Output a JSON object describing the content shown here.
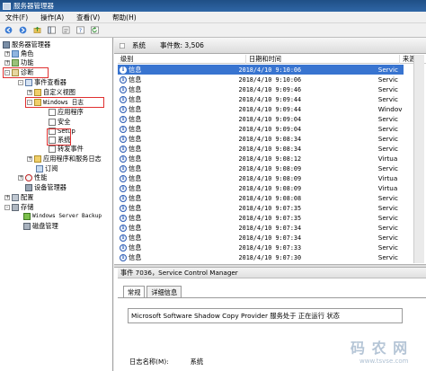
{
  "window": {
    "title": "服务器管理器"
  },
  "menu": [
    "文件(F)",
    "操作(A)",
    "查看(V)",
    "帮助(H)"
  ],
  "toolbar": {
    "icons": [
      "back-arrow-icon",
      "forward-arrow-icon",
      "up-folder-icon",
      "show-tree-icon",
      "properties-icon",
      "help-icon",
      "refresh-icon"
    ]
  },
  "tree": {
    "items": [
      {
        "label": "服务器管理器",
        "icon": "server-icon"
      },
      {
        "label": "角色",
        "icon": "roles-icon"
      },
      {
        "label": "功能",
        "icon": "features-icon"
      },
      {
        "label": "诊断",
        "icon": "diagnostics-icon"
      },
      {
        "label": "事件查看器",
        "icon": "event-viewer-icon"
      },
      {
        "label": "自定义视图",
        "icon": "folder-icon"
      },
      {
        "label": "Windows 日志",
        "icon": "folder-icon"
      },
      {
        "label": "应用程序",
        "icon": "log-icon"
      },
      {
        "label": "安全",
        "icon": "log-icon"
      },
      {
        "label": "Setup",
        "icon": "log-icon"
      },
      {
        "label": "系统",
        "icon": "log-icon"
      },
      {
        "label": "转发事件",
        "icon": "log-icon"
      },
      {
        "label": "应用程序和服务日志",
        "icon": "folder-icon"
      },
      {
        "label": "订阅",
        "icon": "subscription-icon"
      },
      {
        "label": "性能",
        "icon": "performance-icon"
      },
      {
        "label": "设备管理器",
        "icon": "device-manager-icon"
      },
      {
        "label": "配置",
        "icon": "configuration-icon"
      },
      {
        "label": "存储",
        "icon": "storage-icon"
      },
      {
        "label": "Windows Server Backup",
        "icon": "backup-icon"
      },
      {
        "label": "磁盘管理",
        "icon": "disk-icon"
      }
    ]
  },
  "list": {
    "log_name": "系统",
    "event_count": "事件数: 3,506",
    "columns": [
      "级别",
      "日期和时间",
      "来源"
    ],
    "rows": [
      {
        "level": "信息",
        "datetime": "2018/4/10 9:10:06",
        "source": "Servic",
        "selected": true
      },
      {
        "level": "信息",
        "datetime": "2018/4/10 9:10:06",
        "source": "Servic"
      },
      {
        "level": "信息",
        "datetime": "2018/4/10 9:09:46",
        "source": "Servic"
      },
      {
        "level": "信息",
        "datetime": "2018/4/10 9:09:44",
        "source": "Servic"
      },
      {
        "level": "信息",
        "datetime": "2018/4/10 9:09:44",
        "source": "Windov"
      },
      {
        "level": "信息",
        "datetime": "2018/4/10 9:09:04",
        "source": "Servic"
      },
      {
        "level": "信息",
        "datetime": "2018/4/10 9:09:04",
        "source": "Servic"
      },
      {
        "level": "信息",
        "datetime": "2018/4/10 9:08:34",
        "source": "Servic"
      },
      {
        "level": "信息",
        "datetime": "2018/4/10 9:08:34",
        "source": "Servic"
      },
      {
        "level": "信息",
        "datetime": "2018/4/10 9:08:12",
        "source": "Virtua"
      },
      {
        "level": "信息",
        "datetime": "2018/4/10 9:08:09",
        "source": "Servic"
      },
      {
        "level": "信息",
        "datetime": "2018/4/10 9:08:09",
        "source": "Virtua"
      },
      {
        "level": "信息",
        "datetime": "2018/4/10 9:08:09",
        "source": "Virtua"
      },
      {
        "level": "信息",
        "datetime": "2018/4/10 9:08:08",
        "source": "Servic"
      },
      {
        "level": "信息",
        "datetime": "2018/4/10 9:07:35",
        "source": "Servic"
      },
      {
        "level": "信息",
        "datetime": "2018/4/10 9:07:35",
        "source": "Servic"
      },
      {
        "level": "信息",
        "datetime": "2018/4/10 9:07:34",
        "source": "Servic"
      },
      {
        "level": "信息",
        "datetime": "2018/4/10 9:07:34",
        "source": "Servic"
      },
      {
        "level": "信息",
        "datetime": "2018/4/10 9:07:33",
        "source": "Servic"
      },
      {
        "level": "信息",
        "datetime": "2018/4/10 9:07:30",
        "source": "Servic"
      }
    ]
  },
  "detail": {
    "header": "事件 7036，Service Control Manager",
    "tabs": [
      "常规",
      "详细信息"
    ],
    "message": "Microsoft Software Shadow Copy Provider 服务处于 正在运行 状态",
    "log_label": "日志名称(M):",
    "log_value": "系统"
  },
  "watermark": {
    "cn": "码 农 网",
    "url": "www.tsvse.com"
  },
  "colors": {
    "selection": "#3874d0",
    "highlight_box": "#e03030",
    "titlebar": "#2f66a6"
  }
}
